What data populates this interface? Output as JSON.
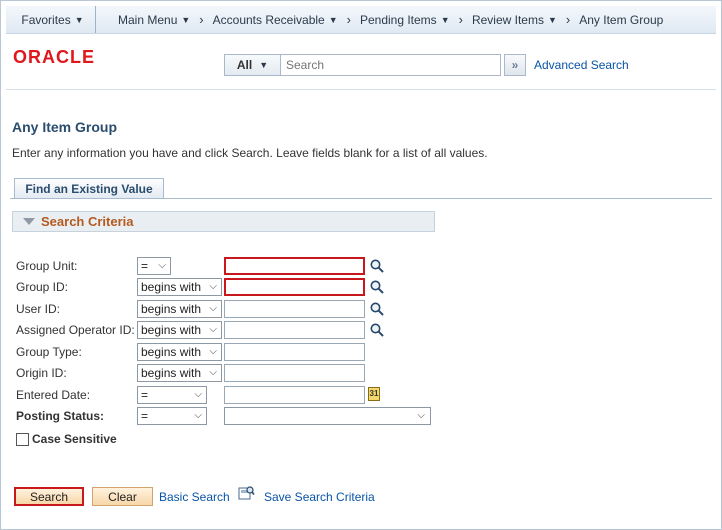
{
  "nav": {
    "favorites": "Favorites",
    "main_menu": "Main Menu",
    "breadcrumbs": [
      "Accounts Receivable",
      "Pending Items",
      "Review Items",
      "Any Item Group"
    ]
  },
  "header": {
    "logo": "ORACLE",
    "search_scope": "All",
    "search_placeholder": "Search",
    "advanced_search": "Advanced Search"
  },
  "page": {
    "title": "Any Item Group",
    "instructions": "Enter any information you have and click Search. Leave fields blank for a list of all values.",
    "tab": "Find an Existing Value",
    "section": "Search Criteria"
  },
  "fields": [
    {
      "label": "Group Unit:",
      "operator": "=",
      "required": true,
      "lookup": true
    },
    {
      "label": "Group ID:",
      "operator": "begins with",
      "required": true,
      "lookup": true
    },
    {
      "label": "User ID:",
      "operator": "begins with",
      "required": false,
      "lookup": true
    },
    {
      "label": "Assigned Operator ID:",
      "operator": "begins with",
      "required": false,
      "lookup": true
    },
    {
      "label": "Group Type:",
      "operator": "begins with",
      "required": false,
      "lookup": false
    },
    {
      "label": "Origin ID:",
      "operator": "begins with",
      "required": false,
      "lookup": false
    },
    {
      "label": "Entered Date:",
      "operator": "=",
      "required": false,
      "calendar": true
    },
    {
      "label": "Posting Status:",
      "operator": "=",
      "required": false,
      "dropdown_value": ""
    }
  ],
  "case_sensitive": {
    "label": "Case Sensitive",
    "checked": false
  },
  "buttons": {
    "search": "Search",
    "clear": "Clear",
    "basic_search": "Basic Search",
    "save_search": "Save Search Criteria"
  },
  "colors": {
    "required_border": "#c8171d",
    "link": "#0a54a7",
    "title": "#2a4d6e",
    "section_text": "#b55a1f"
  },
  "icons": {
    "lookup": "magnifier-icon",
    "calendar": "calendar-icon",
    "save": "save-search-icon"
  }
}
